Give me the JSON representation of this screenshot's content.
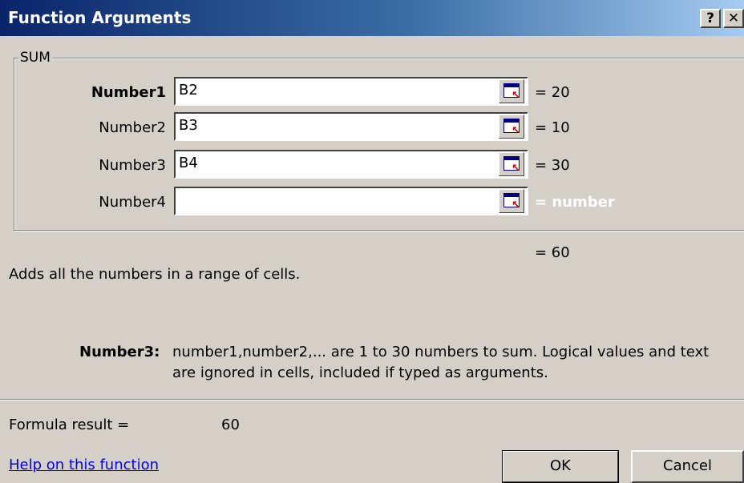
{
  "window": {
    "title": "Function Arguments",
    "help_button": "?",
    "close_button": "✕"
  },
  "function": {
    "name": "SUM",
    "arguments": [
      {
        "label": "Number1",
        "value": "B2",
        "result": "= 20",
        "active": false
      },
      {
        "label": "Number2",
        "value": "B3",
        "result": "= 10",
        "active": false
      },
      {
        "label": "Number3",
        "value": "B4",
        "result": "= 30",
        "active": true
      },
      {
        "label": "Number4",
        "value": "",
        "result": "= number",
        "active": false
      }
    ],
    "overall_result": "= 60",
    "description": "Adds all the numbers in a range of cells."
  },
  "argument_help": {
    "name": "Number3:",
    "line1": "number1,number2,... are 1 to 30 numbers to sum. Logical values and text",
    "line2": "are ignored in cells, included if typed as arguments."
  },
  "formula": {
    "label": "Formula result =",
    "value": "60"
  },
  "footer": {
    "help_link": "Help on this function",
    "ok_label": "OK",
    "cancel_label": "Cancel"
  },
  "icons": {
    "collapse_dialog": "range-select-icon"
  }
}
